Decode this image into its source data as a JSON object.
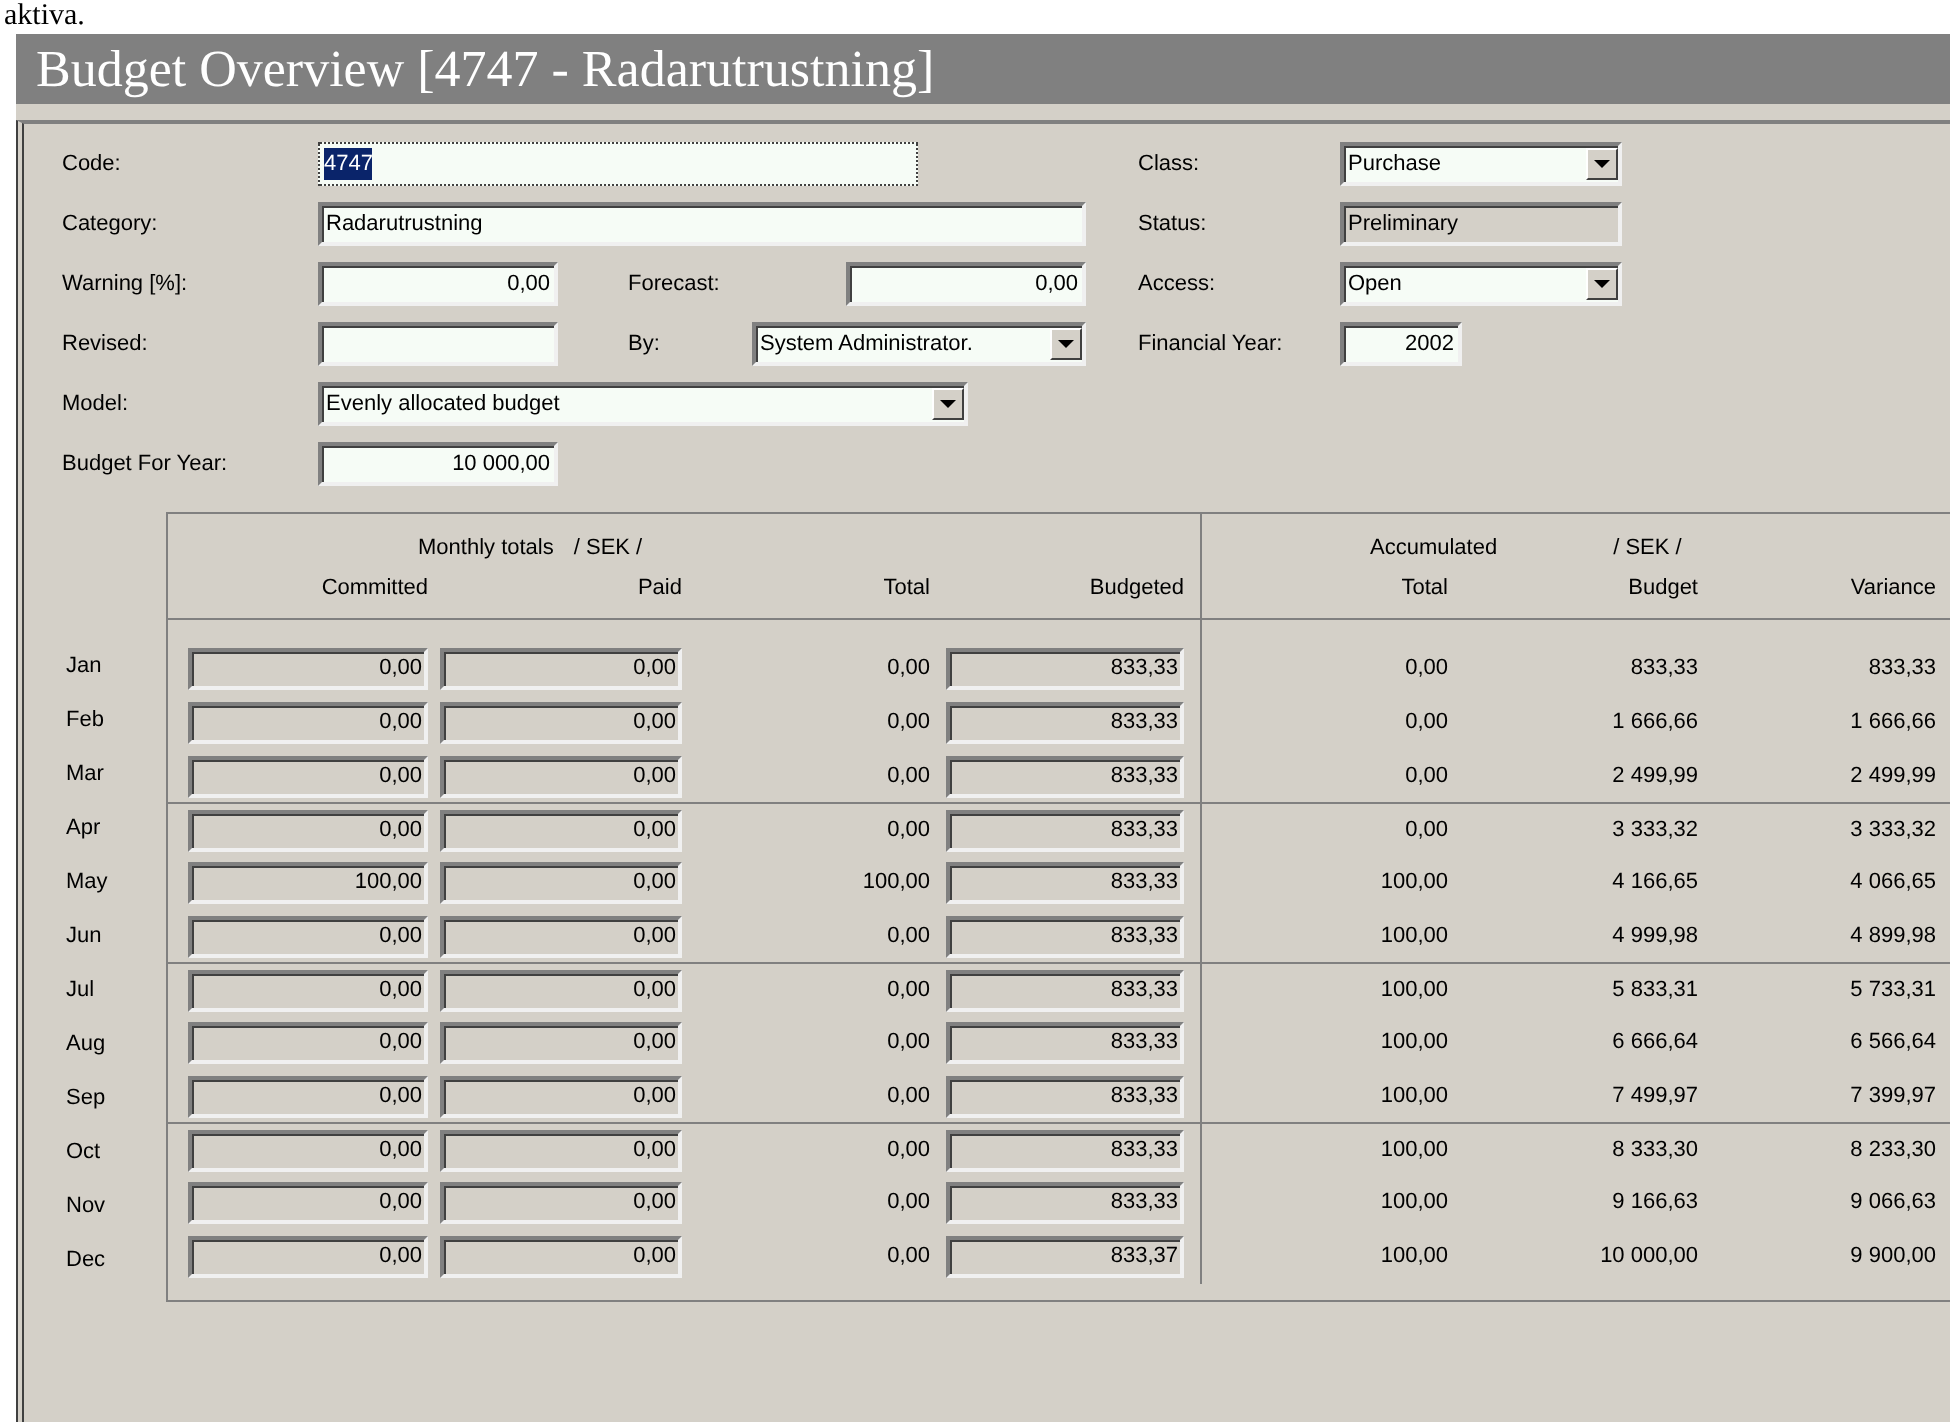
{
  "page_text": "aktiva.",
  "window": {
    "title": "Budget Overview [4747 - Radarutrustning]"
  },
  "form": {
    "code": {
      "label": "Code:",
      "value": "4747",
      "text_selected": true
    },
    "category": {
      "label": "Category:",
      "value": "Radarutrustning"
    },
    "warning": {
      "label": "Warning [%]:",
      "value": "0,00"
    },
    "forecast": {
      "label": "Forecast:",
      "value": "0,00"
    },
    "revised": {
      "label": "Revised:"
    },
    "by": {
      "label": "By:",
      "value": "System Administrator."
    },
    "model": {
      "label": "Model:",
      "value": "Evenly allocated budget"
    },
    "budget_for_year": {
      "label": "Budget For Year:",
      "value": "10 000,00"
    },
    "class": {
      "label": "Class:",
      "value": "Purchase"
    },
    "status": {
      "label": "Status:",
      "value": "Preliminary",
      "disabled": true
    },
    "access": {
      "label": "Access:",
      "value": "Open"
    },
    "financial_year": {
      "label": "Financial Year:",
      "value": "2002"
    }
  },
  "table": {
    "monthly_title": "Monthly totals",
    "monthly_unit": "/ SEK /",
    "accumulated_title": "Accumulated",
    "accumulated_unit": "/ SEK /",
    "columns": [
      "Committed",
      "Paid",
      "Total",
      "Budgeted",
      "Total",
      "Budget",
      "Variance"
    ],
    "rows": [
      {
        "month": "Jan",
        "committed": "0,00",
        "paid": "0,00",
        "total": "0,00",
        "budgeted": "833,33",
        "acc_total": "0,00",
        "acc_budget": "833,33",
        "variance": "833,33"
      },
      {
        "month": "Feb",
        "committed": "0,00",
        "paid": "0,00",
        "total": "0,00",
        "budgeted": "833,33",
        "acc_total": "0,00",
        "acc_budget": "1 666,66",
        "variance": "1 666,66"
      },
      {
        "month": "Mar",
        "committed": "0,00",
        "paid": "0,00",
        "total": "0,00",
        "budgeted": "833,33",
        "acc_total": "0,00",
        "acc_budget": "2 499,99",
        "variance": "2 499,99"
      },
      {
        "month": "Apr",
        "committed": "0,00",
        "paid": "0,00",
        "total": "0,00",
        "budgeted": "833,33",
        "acc_total": "0,00",
        "acc_budget": "3 333,32",
        "variance": "3 333,32"
      },
      {
        "month": "May",
        "committed": "100,00",
        "paid": "0,00",
        "total": "100,00",
        "budgeted": "833,33",
        "acc_total": "100,00",
        "acc_budget": "4 166,65",
        "variance": "4 066,65"
      },
      {
        "month": "Jun",
        "committed": "0,00",
        "paid": "0,00",
        "total": "0,00",
        "budgeted": "833,33",
        "acc_total": "100,00",
        "acc_budget": "4 999,98",
        "variance": "4 899,98"
      },
      {
        "month": "Jul",
        "committed": "0,00",
        "paid": "0,00",
        "total": "0,00",
        "budgeted": "833,33",
        "acc_total": "100,00",
        "acc_budget": "5 833,31",
        "variance": "5 733,31"
      },
      {
        "month": "Aug",
        "committed": "0,00",
        "paid": "0,00",
        "total": "0,00",
        "budgeted": "833,33",
        "acc_total": "100,00",
        "acc_budget": "6 666,64",
        "variance": "6 566,64"
      },
      {
        "month": "Sep",
        "committed": "0,00",
        "paid": "0,00",
        "total": "0,00",
        "budgeted": "833,33",
        "acc_total": "100,00",
        "acc_budget": "7 499,97",
        "variance": "7 399,97"
      },
      {
        "month": "Oct",
        "committed": "0,00",
        "paid": "0,00",
        "total": "0,00",
        "budgeted": "833,33",
        "acc_total": "100,00",
        "acc_budget": "8 333,30",
        "variance": "8 233,30"
      },
      {
        "month": "Nov",
        "committed": "0,00",
        "paid": "0,00",
        "total": "0,00",
        "budgeted": "833,33",
        "acc_total": "100,00",
        "acc_budget": "9 166,63",
        "variance": "9 066,63"
      },
      {
        "month": "Dec",
        "committed": "0,00",
        "paid": "0,00",
        "total": "0,00",
        "budgeted": "833,37",
        "acc_total": "100,00",
        "acc_budget": "10 000,00",
        "variance": "9 900,00"
      }
    ]
  }
}
